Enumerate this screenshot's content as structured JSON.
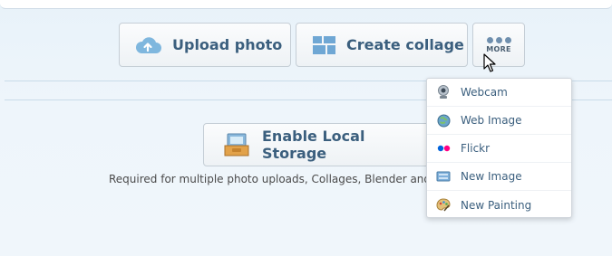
{
  "toolbar": {
    "upload_label": "Upload photo",
    "collage_label": "Create collage",
    "more_label": "MORE"
  },
  "storage": {
    "button_label": "Enable Local Storage",
    "note": "Required for multiple photo uploads, Collages, Blender and"
  },
  "more_menu": {
    "items": [
      {
        "label": "Webcam",
        "icon": "webcam-icon"
      },
      {
        "label": "Web Image",
        "icon": "globe-icon"
      },
      {
        "label": "Flickr",
        "icon": "flickr-icon"
      },
      {
        "label": "New Image",
        "icon": "new-image-icon"
      },
      {
        "label": "New Painting",
        "icon": "palette-icon"
      }
    ]
  },
  "colors": {
    "accent_text": "#3b5f7e",
    "background": "#eef5fb",
    "flickr_blue": "#0063dc",
    "flickr_pink": "#ff0084"
  }
}
